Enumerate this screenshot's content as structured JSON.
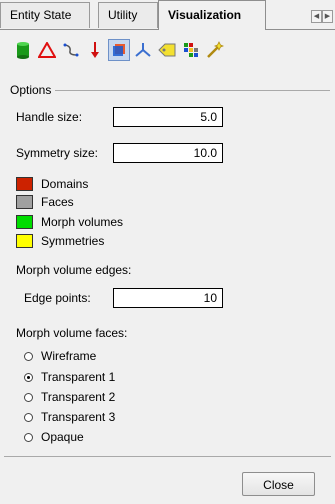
{
  "tabs": [
    {
      "label": "Entity State"
    },
    {
      "label": "Utility"
    },
    {
      "label": "Visualization",
      "active": true
    }
  ],
  "toolbar": {
    "icons": [
      "cylinder-icon",
      "triangle-icon",
      "curve-icon",
      "arrow-down-icon",
      "cube-icon",
      "axes-icon",
      "tag-icon",
      "grid-icon",
      "wand-icon"
    ]
  },
  "options": {
    "group_label": "Options",
    "handle_size_label": "Handle size:",
    "handle_size_value": "5.0",
    "symmetry_size_label": "Symmetry size:",
    "symmetry_size_value": "10.0"
  },
  "legend": [
    {
      "label": "Domains",
      "color": "#cc2200"
    },
    {
      "label": "Faces",
      "color": "#a0a0a0"
    },
    {
      "label": "Morph volumes",
      "color": "#00dd00"
    },
    {
      "label": "Symmetries",
      "color": "#ffff00"
    }
  ],
  "edges": {
    "heading": "Morph volume edges:",
    "edge_points_label": "Edge points:",
    "edge_points_value": "10"
  },
  "faces": {
    "heading": "Morph volume faces:",
    "options": [
      {
        "label": "Wireframe",
        "checked": false
      },
      {
        "label": "Transparent 1",
        "checked": true
      },
      {
        "label": "Transparent 2",
        "checked": false
      },
      {
        "label": "Transparent 3",
        "checked": false
      },
      {
        "label": "Opaque",
        "checked": false
      }
    ]
  },
  "footer": {
    "close_label": "Close"
  }
}
